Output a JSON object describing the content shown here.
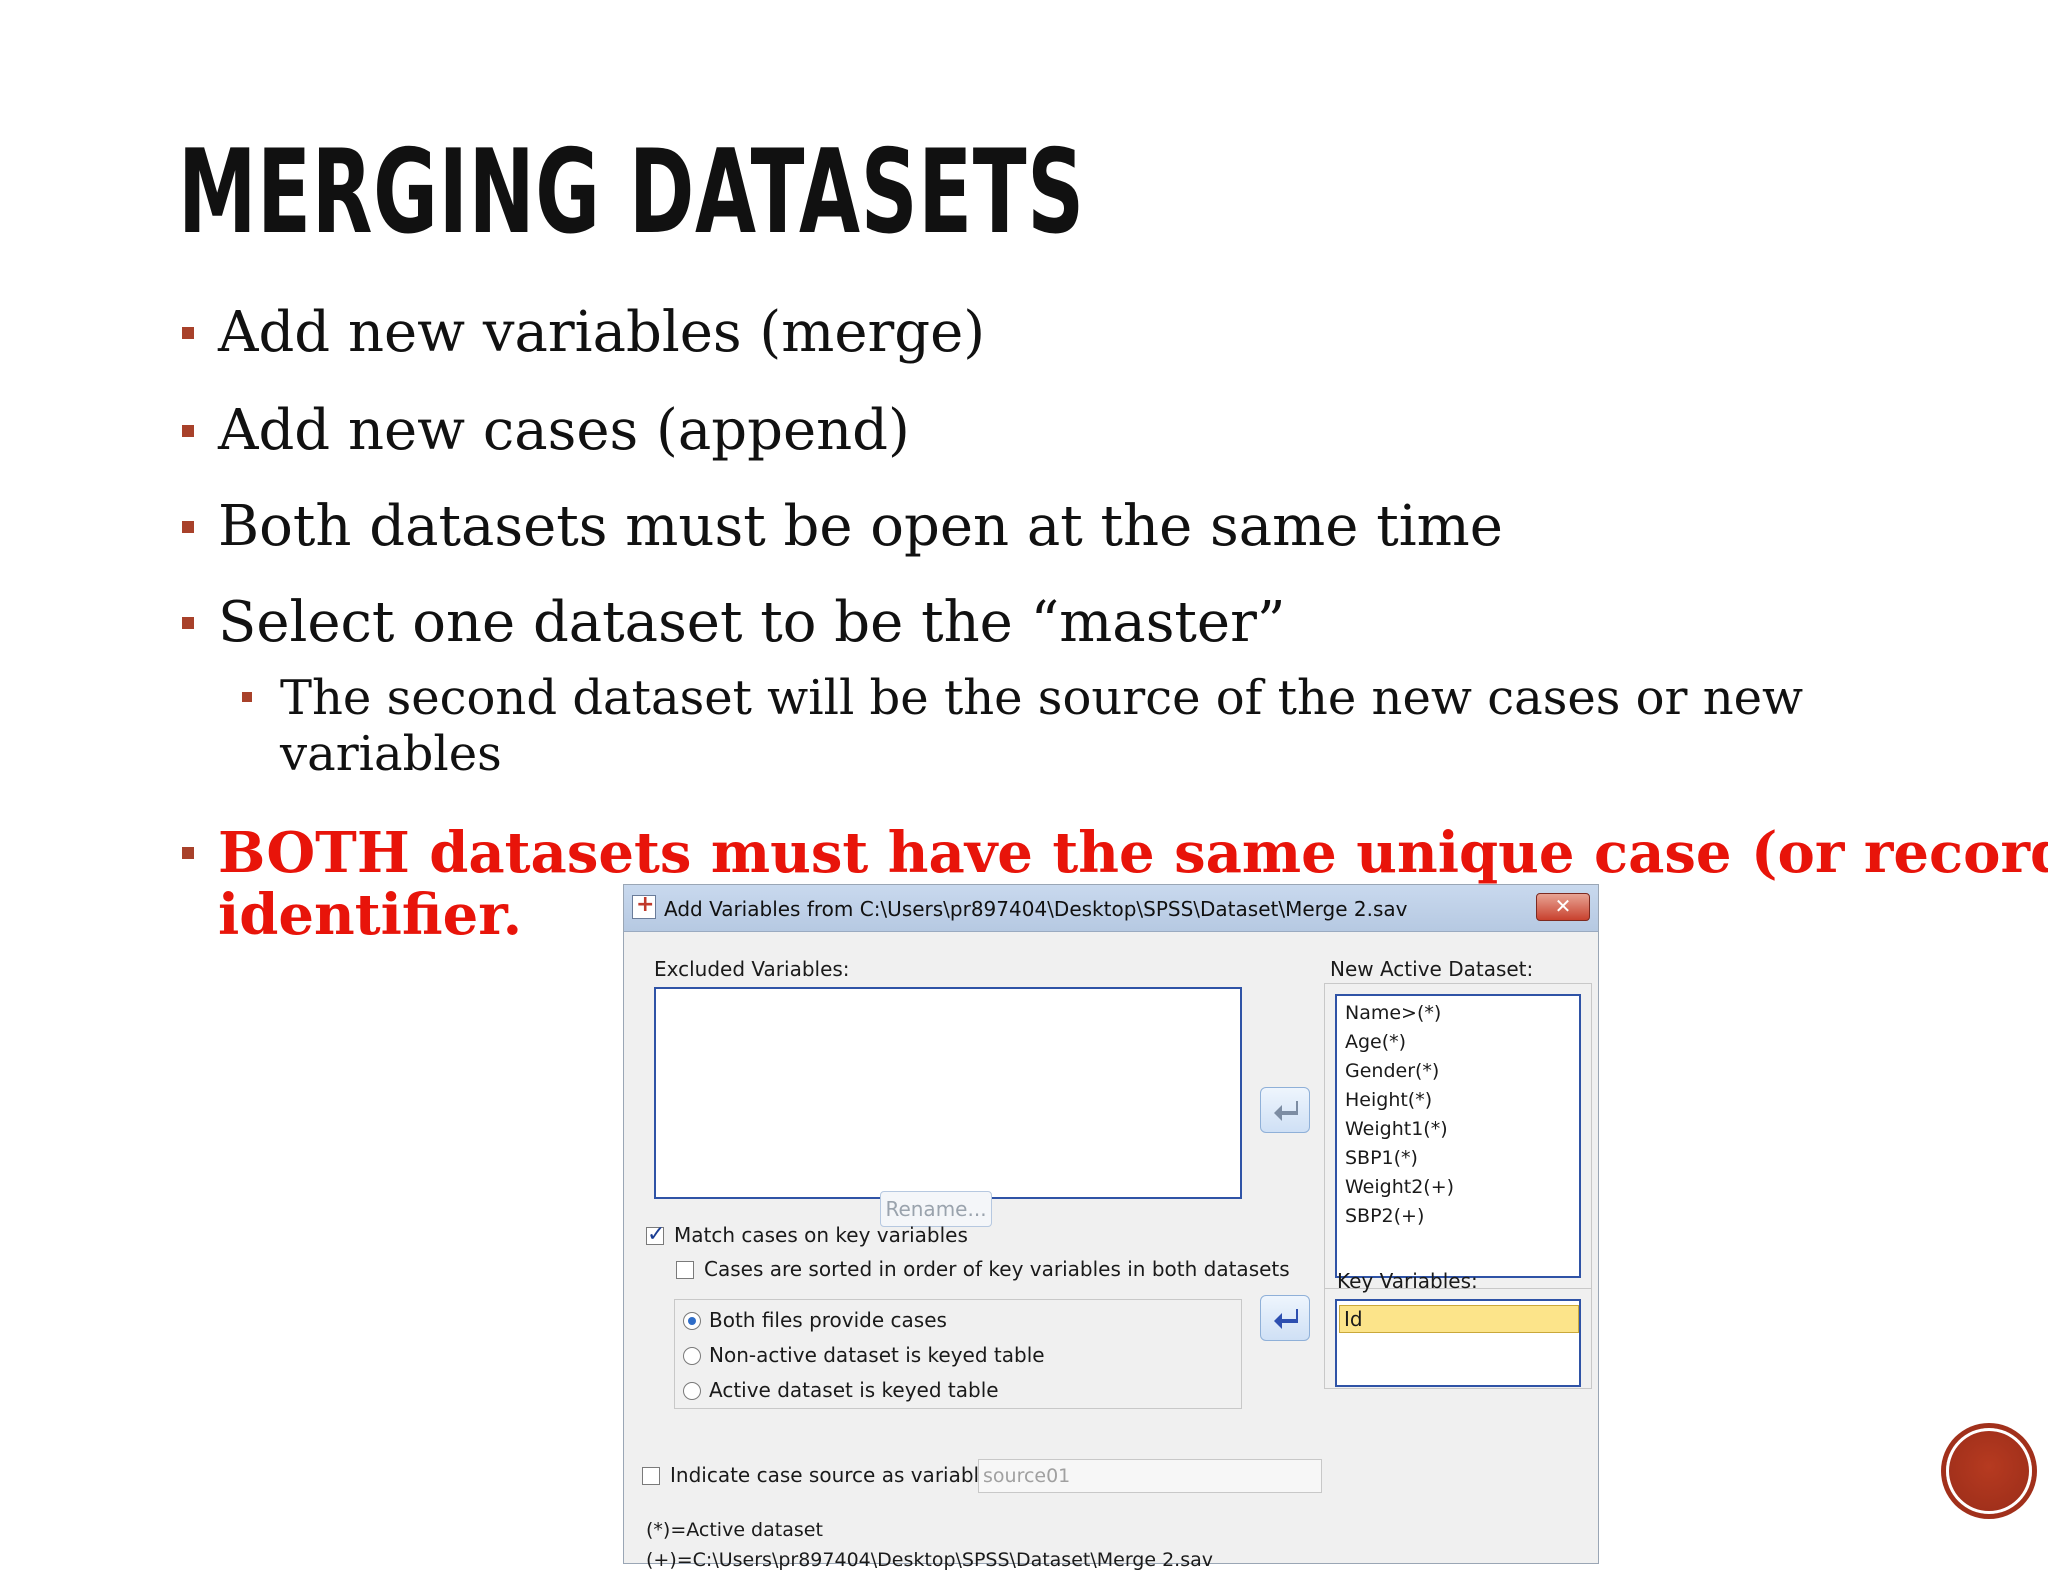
{
  "slide": {
    "title": "MERGING DATASETS",
    "bullets": [
      "Add new variables (merge)",
      "Add new cases (append)",
      "Both datasets must be open at the same time",
      "Select one dataset to be the “master”"
    ],
    "sub_bullet_line1": "The second dataset will be the source of the new cases or new",
    "sub_bullet_line2": "variables",
    "highlight_line1": "BOTH datasets must have the same unique case (or record)",
    "highlight_line2": "identifier.",
    "highlight_color": "#e8140a",
    "bullet_color": "#a8412a"
  },
  "dialog": {
    "title": "Add Variables from C:\\Users\\pr897404\\Desktop\\SPSS\\Dataset\\Merge 2.sav",
    "close_label": "✕",
    "excluded_label": "Excluded Variables:",
    "rename_label": "Rename...",
    "new_active_label": "New Active Dataset:",
    "new_active_items": [
      "Name>(*)",
      "Age(*)",
      "Gender(*)",
      "Height(*)",
      "Weight1(*)",
      "SBP1(*)",
      "Weight2(+)",
      "SBP2(+)"
    ],
    "key_label": "Key Variables:",
    "key_items": [
      "Id"
    ],
    "match_label": "Match cases on key variables",
    "match_checked": true,
    "sorted_label": "Cases are sorted in order of key variables in both datasets",
    "sorted_checked": false,
    "radio_options": [
      "Both files provide cases",
      "Non-active dataset is keyed table",
      "Active dataset is keyed table"
    ],
    "radio_selected": 0,
    "indicate_label": "Indicate case source as variable:",
    "indicate_checked": false,
    "source_value": "source01",
    "legend_active": "(*)=Active dataset",
    "legend_other": "(+)=C:\\Users\\pr897404\\Desktop\\SPSS\\Dataset\\Merge 2.sav"
  },
  "icons": {
    "app": "spss-dialog-icon",
    "arrow": "move-left-arrow-icon",
    "nav": "slide-nav-icon"
  }
}
